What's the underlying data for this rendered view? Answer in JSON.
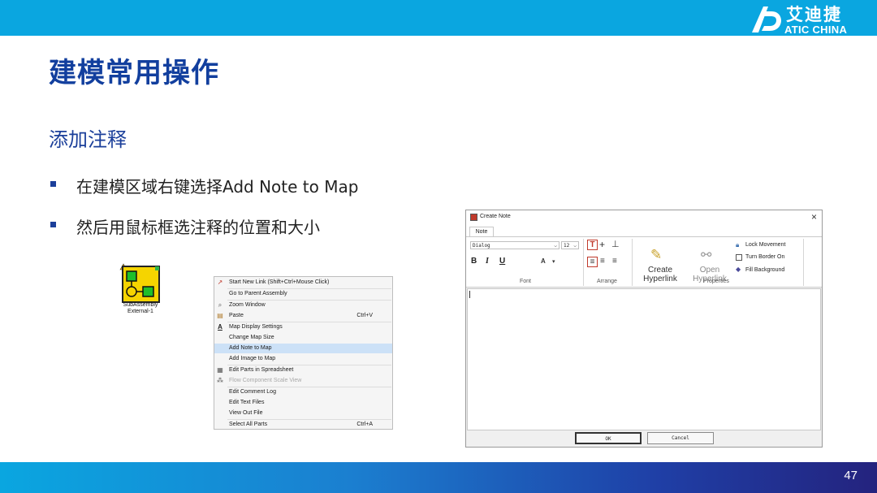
{
  "logo": {
    "cn": "艾迪捷",
    "en": "ATIC CHINA"
  },
  "title": "建模常用操作",
  "subtitle": "添加注释",
  "bullets": [
    "在建模区域右键选择Add Note to Map",
    "然后用鼠标框选注释的位置和大小"
  ],
  "page_number": "47",
  "subassembly": {
    "line1": "SubAssembly",
    "line2": "External-1"
  },
  "context_menu": {
    "items": [
      {
        "label": "Start New Link (Shift+Ctrl+Mouse Click)",
        "shortcut": "",
        "icon": "link-icon"
      },
      {
        "label": "Go to Parent Assembly",
        "shortcut": "",
        "icon": ""
      },
      {
        "label": "Zoom Window",
        "shortcut": "",
        "icon": "zoom-icon"
      },
      {
        "label": "Paste",
        "shortcut": "Ctrl+V",
        "icon": "paste-icon"
      },
      {
        "label": "Map Display Settings",
        "shortcut": "",
        "icon": "text-style-icon"
      },
      {
        "label": "Change Map Size",
        "shortcut": "",
        "icon": ""
      },
      {
        "label": "Add Note to Map",
        "shortcut": "",
        "icon": ""
      },
      {
        "label": "Add Image to Map",
        "shortcut": "",
        "icon": ""
      },
      {
        "label": "Edit Parts in Spreadsheet",
        "shortcut": "",
        "icon": "spreadsheet-icon"
      },
      {
        "label": "Flow Component Scale View",
        "shortcut": "",
        "icon": "scale-icon"
      },
      {
        "label": "Edit Comment Log",
        "shortcut": "",
        "icon": ""
      },
      {
        "label": "Edit Text Files",
        "shortcut": "",
        "icon": ""
      },
      {
        "label": "View Out File",
        "shortcut": "",
        "icon": ""
      },
      {
        "label": "Select All Parts",
        "shortcut": "Ctrl+A",
        "icon": ""
      }
    ]
  },
  "dialog": {
    "title": "Create Note",
    "tab": "Note",
    "font_name": "Dialog",
    "font_size": "12",
    "bold": "B",
    "italic": "I",
    "underline": "U",
    "font_color": "A",
    "group_font": "Font",
    "group_arrange": "Arrange",
    "group_properties": "Properties",
    "create_hyperlink": "Create Hyperlink",
    "open_hyperlink": "Open Hyperlink",
    "lock_movement": "Lock Movement",
    "turn_border_on": "Turn Border On",
    "fill_background": "Fill Background",
    "ok": "OK",
    "cancel": "Cancel"
  },
  "colors": {
    "brand_blue": "#0aa6e0",
    "title_blue": "#123f9e",
    "highlight": "#cce1f7"
  }
}
